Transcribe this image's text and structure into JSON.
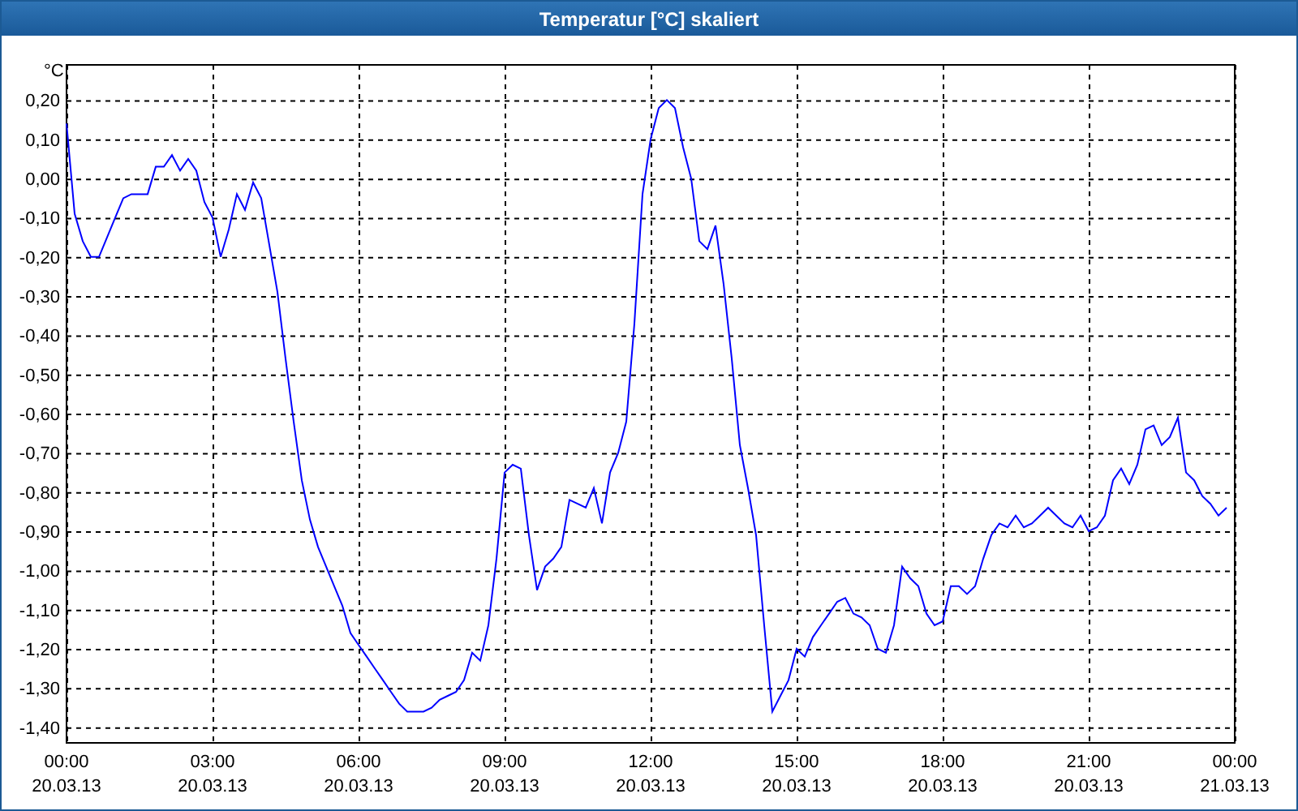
{
  "window": {
    "title": "Temperatur [°C] skaliert"
  },
  "chart": {
    "chart_data": {
      "type": "line",
      "grid": true,
      "ylabel": "°C",
      "ylim": [
        -1.44,
        0.29
      ],
      "yticks": [
        {
          "value": 0.2,
          "label": "0,20"
        },
        {
          "value": 0.1,
          "label": "0,10"
        },
        {
          "value": 0,
          "label": "0,00"
        },
        {
          "value": -0.1,
          "label": "-0,10"
        },
        {
          "value": -0.2,
          "label": "-0,20"
        },
        {
          "value": -0.3,
          "label": "-0,30"
        },
        {
          "value": -0.4,
          "label": "-0,40"
        },
        {
          "value": -0.5,
          "label": "-0,50"
        },
        {
          "value": -0.6,
          "label": "-0,60"
        },
        {
          "value": -0.7,
          "label": "-0,70"
        },
        {
          "value": -0.8,
          "label": "-0,80"
        },
        {
          "value": -0.9,
          "label": "-0,90"
        },
        {
          "value": -1.0,
          "label": "-1,00"
        },
        {
          "value": -1.1,
          "label": "-1,10"
        },
        {
          "value": -1.2,
          "label": "-1,20"
        },
        {
          "value": -1.3,
          "label": "-1,30"
        },
        {
          "value": -1.4,
          "label": "-1,40"
        }
      ],
      "categories": [
        "00:00\n20.03.13",
        null,
        null,
        null,
        null,
        null,
        null,
        null,
        null,
        null,
        null,
        null,
        null,
        null,
        null,
        null,
        null,
        null,
        "03:00\n20.03.13",
        null,
        null,
        null,
        null,
        null,
        null,
        null,
        null,
        null,
        null,
        null,
        null,
        null,
        null,
        null,
        null,
        null,
        "06:00\n20.03.13",
        null,
        null,
        null,
        null,
        null,
        null,
        null,
        null,
        null,
        null,
        null,
        null,
        null,
        null,
        null,
        null,
        null,
        "09:00\n20.03.13",
        null,
        null,
        null,
        null,
        null,
        null,
        null,
        null,
        null,
        null,
        null,
        null,
        null,
        null,
        null,
        null,
        null,
        "12:00\n20.03.13",
        null,
        null,
        null,
        null,
        null,
        null,
        null,
        null,
        null,
        null,
        null,
        null,
        null,
        null,
        null,
        null,
        null,
        "15:00\n20.03.13",
        null,
        null,
        null,
        null,
        null,
        null,
        null,
        null,
        null,
        null,
        null,
        null,
        null,
        null,
        null,
        null,
        null,
        "18:00\n20.03.13",
        null,
        null,
        null,
        null,
        null,
        null,
        null,
        null,
        null,
        null,
        null,
        null,
        null,
        null,
        null,
        null,
        null,
        "21:00\n20.03.13",
        null,
        null,
        null,
        null,
        null,
        null,
        null,
        null,
        null,
        null,
        null,
        null,
        null,
        null,
        null,
        null,
        null,
        "00:00\n21.03.13"
      ],
      "series": [
        {
          "color": "#0000ff",
          "values": [
            0.14,
            -0.09,
            -0.16,
            -0.2,
            -0.2,
            -0.15,
            -0.1,
            -0.05,
            -0.04,
            -0.04,
            -0.04,
            0.03,
            0.03,
            0.06,
            0.02,
            0.05,
            0.02,
            -0.06,
            -0.1,
            -0.2,
            -0.13,
            -0.04,
            -0.08,
            -0.01,
            -0.05,
            -0.17,
            -0.29,
            -0.46,
            -0.62,
            -0.77,
            -0.87,
            -0.94,
            -0.99,
            -1.04,
            -1.09,
            -1.16,
            -1.19,
            -1.22,
            -1.25,
            -1.28,
            -1.31,
            -1.34,
            -1.36,
            -1.36,
            -1.36,
            -1.35,
            -1.33,
            -1.32,
            -1.31,
            -1.28,
            -1.21,
            -1.23,
            -1.14,
            -0.97,
            -0.75,
            -0.73,
            -0.74,
            -0.91,
            -1.05,
            -0.99,
            -0.97,
            -0.94,
            -0.82,
            -0.83,
            -0.84,
            -0.79,
            -0.88,
            -0.75,
            -0.7,
            -0.62,
            -0.37,
            -0.04,
            0.1,
            0.18,
            0.2,
            0.18,
            0.08,
            0.0,
            -0.16,
            -0.18,
            -0.12,
            -0.27,
            -0.46,
            -0.68,
            -0.79,
            -0.91,
            -1.14,
            -1.36,
            -1.32,
            -1.28,
            -1.2,
            -1.22,
            -1.17,
            -1.14,
            -1.11,
            -1.08,
            -1.07,
            -1.11,
            -1.12,
            -1.14,
            -1.2,
            -1.21,
            -1.14,
            -0.99,
            -1.02,
            -1.04,
            -1.11,
            -1.14,
            -1.13,
            -1.04,
            -1.04,
            -1.06,
            -1.04,
            -0.97,
            -0.91,
            -0.88,
            -0.89,
            -0.86,
            -0.89,
            -0.88,
            -0.86,
            -0.84,
            -0.86,
            -0.88,
            -0.89,
            -0.86,
            -0.9,
            -0.89,
            -0.86,
            -0.77,
            -0.74,
            -0.78,
            -0.73,
            -0.64,
            -0.63,
            -0.68,
            -0.66,
            -0.61,
            -0.75,
            -0.77,
            -0.81,
            -0.83,
            -0.86,
            -0.84,
            null
          ]
        }
      ]
    }
  }
}
